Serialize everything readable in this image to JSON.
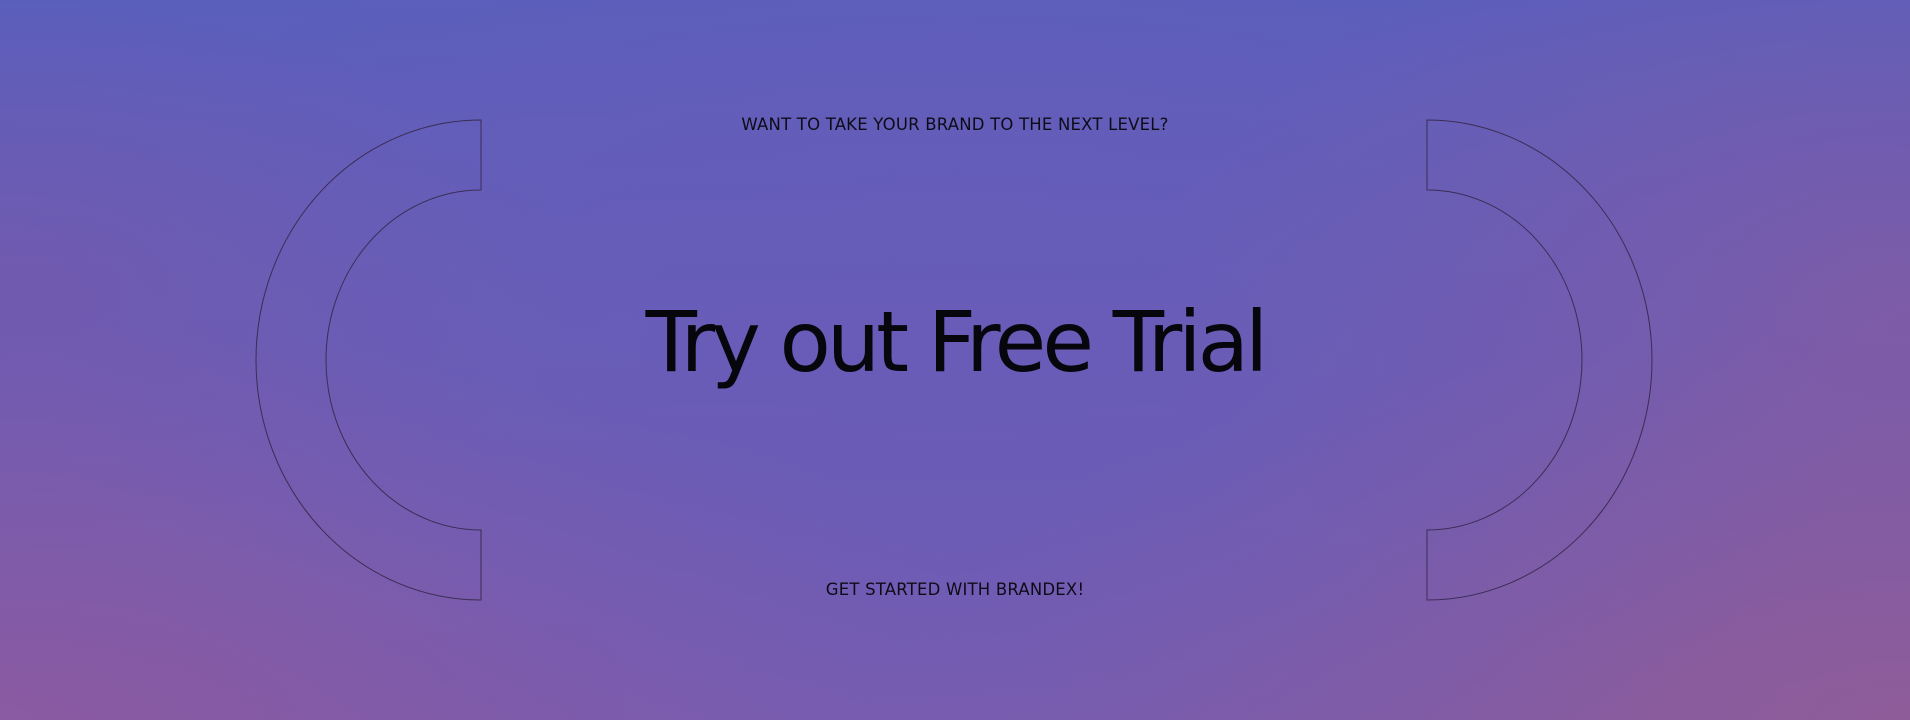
{
  "cta": {
    "eyebrow": "WANT TO TAKE YOUR BRAND TO THE NEXT LEVEL?",
    "headline": "Try out Free Trial",
    "link_label": "GET STARTED WITH BRANDEX!"
  },
  "decor": {
    "left_icon": "left-bracket-arc-icon",
    "right_icon": "right-bracket-arc-icon",
    "stroke_color": "#3a2d55"
  },
  "colors": {
    "background_top": "#5b5fbc",
    "background_bottom": "#785cb0",
    "text": "#0c0b12"
  }
}
